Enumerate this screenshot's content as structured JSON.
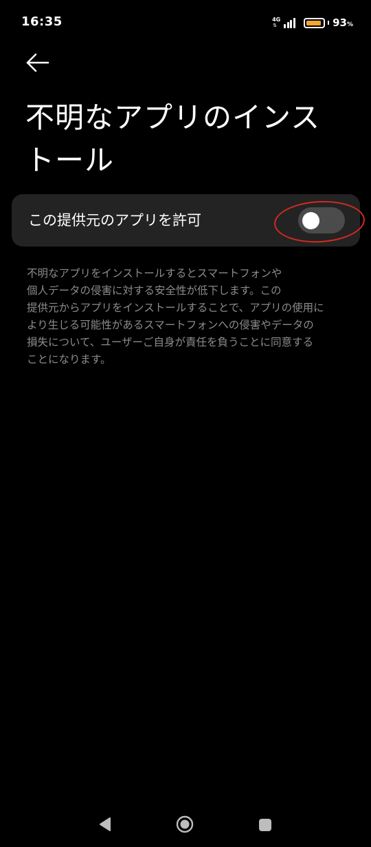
{
  "status_bar": {
    "time": "16:35",
    "network_type": "4G",
    "network_arrows": "⇅",
    "signal_icon": "signal-bars-icon",
    "battery_level": 0.93,
    "battery_value": "93",
    "battery_unit": "%",
    "battery_fill_color": "#f2a634"
  },
  "header": {
    "back_icon": "arrow-left-icon"
  },
  "page": {
    "title": "不明なアプリのインストール"
  },
  "setting": {
    "label": "この提供元のアプリを許可",
    "toggle_on": false,
    "highlight_color": "#d42a1f"
  },
  "description_lines": [
    "不明なアプリをインストールするとスマートフォンや",
    "個人データの侵害に対する安全性が低下します。この",
    "提供元からアプリをインストールすることで、アプリの使用に",
    "より生じる可能性があるスマートフォンへの侵害やデータの",
    "損失について、ユーザーご自身が責任を負うことに同意する",
    "ことになります。"
  ],
  "nav_bar": {
    "back_icon": "nav-back-triangle-icon",
    "home_icon": "nav-home-circle-icon",
    "recents_icon": "nav-recents-square-icon"
  }
}
